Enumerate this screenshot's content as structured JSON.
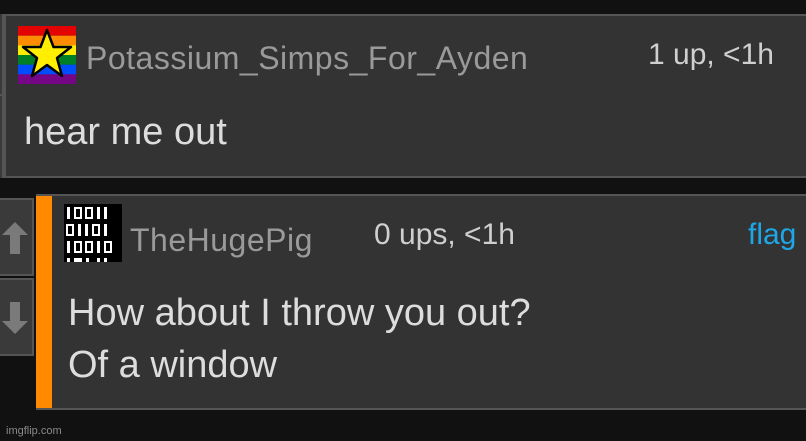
{
  "comments": [
    {
      "username": "Potassium_Simps_For_Ayden",
      "meta": "1 up, <1h",
      "body_lines": [
        "hear me out"
      ],
      "avatar": "rainbow-star-icon"
    },
    {
      "username": "TheHugePig",
      "meta": "0 ups, <1h",
      "flag_label": "flag",
      "body_lines": [
        "How about I throw you out?",
        "Of a window"
      ],
      "avatar": "binary-digits-icon",
      "accent_color": "#ff8a00"
    }
  ],
  "vote_icons": [
    "upvote-arrow-icon",
    "downvote-arrow-icon"
  ],
  "watermark": "imgflip.com",
  "colors": {
    "background": "#111111",
    "panel": "#333333",
    "border": "#555555",
    "link": "#1ea7e6",
    "accent": "#ff8a00"
  }
}
